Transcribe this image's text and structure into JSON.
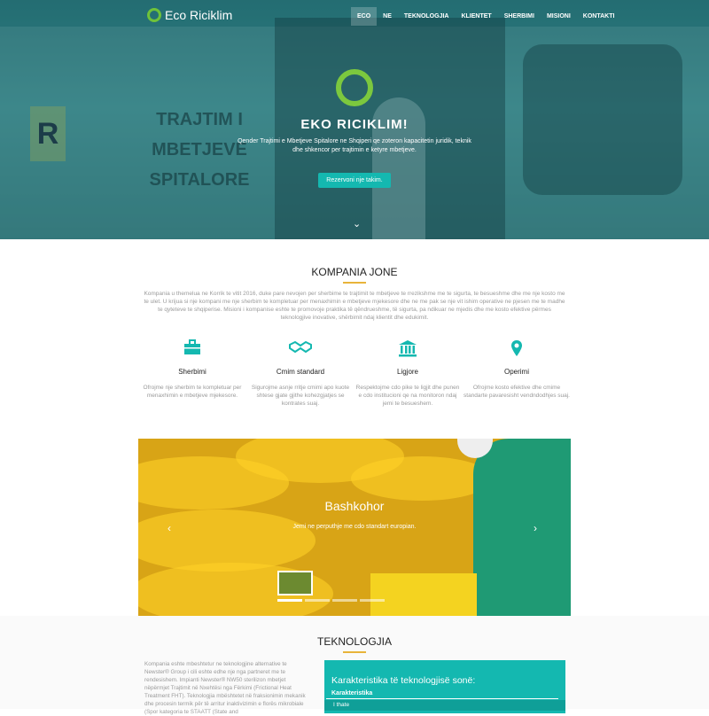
{
  "header": {
    "brand": "Eco Riciklim",
    "menu": [
      {
        "label": "ECO",
        "active": true
      },
      {
        "label": "NE",
        "active": false
      },
      {
        "label": "TEKNOLOGJIA",
        "active": false
      },
      {
        "label": "KLIENTET",
        "active": false
      },
      {
        "label": "SHERBIMI",
        "active": false
      },
      {
        "label": "MISIONI",
        "active": false
      },
      {
        "label": "KONTAKTI",
        "active": false
      }
    ]
  },
  "hero": {
    "van_letter": "R",
    "van_text": "TRAJTIM I MBETJEVE SPITALORE",
    "title": "EKO RICIKLIM!",
    "subtitle": "Qender Trajtimi e Mbetjeve Spitalore ne Shqiperi qe zoteron kapacitetin juridik, teknik dhe shkencor per trajtimin e ketyre mbetjeve.",
    "cta": "Rezervoni nje takim.",
    "scroll_icon": "chevron-down-icon"
  },
  "company": {
    "title": "KOMPANIA JONE",
    "text": "Kompania u themelua ne Korrik te vitit 2016, duke pare nevojen per sherbime te trajtimit te mbetjeve te rrezikshme me te sigurta, te besueshme dhe me nje kosto me te ulet. U krijua si nje kompani me nje sherbim te kompletuar per menaxhimin e mbetjeve mjekesore dhe ne me pak se nje vit ishim operative ne pjesen me te madhe te qyteteve te shqiperise. Misioni i kompanise eshte te promovoje praktika të qëndrueshme, të sigurta, pa ndikuar ne mjedis dhe me kosto efektive përmes teknologjive inovative, shërbimit ndaj klientit dhe edukimit.",
    "features": [
      {
        "icon": "briefcase-icon",
        "title": "Sherbimi",
        "desc": "Ofrojme nje sherbim te kompletuar per menaxhimin e mbetjeve mjekesore."
      },
      {
        "icon": "handshake-icon",
        "title": "Cmim standard",
        "desc": "Sigurojme asnje rritje cmimi apo kuote shtese gjate gjithe kohezgjatjes se kontrates suaj."
      },
      {
        "icon": "institution-icon",
        "title": "Ligjore",
        "desc": "Respektojme cdo pike te ligjit dhe punen e cdo institucioni qe na monitoron ndaj jemi te besueshem."
      },
      {
        "icon": "map-marker-icon",
        "title": "Operimi",
        "desc": "Ofrojme kosto efektive dhe cmime standarte pavaresisht vendndodhjes suaj."
      }
    ]
  },
  "slider": {
    "title": "Bashkohor",
    "subtitle": "Jemi ne perputhje me cdo standart europian.",
    "prev_icon": "chevron-left-icon",
    "next_icon": "chevron-right-icon",
    "active_index": 0,
    "count": 4
  },
  "technology": {
    "title": "TEKNOLOGJIA",
    "text": "Kompania eshte mbeshtetur ne teknologjine alternative te Newster® Group i cili eshte edhe nje nga partneret me te rendesishem. Impianti Newster® NW50 sterilizon mbetjet nëpërmjet Trajtimit në Nxehtësi nga Fërkimi (Frictional Heat Treatment FHT). Teknologjia mbështetet në fraksionimin mekanik dhe procesin termik për të arritur inaktivizimin e florës mikrobiale (Spor kategoria te STAATT (State and",
    "box_title": "Karakteristika të teknologjisë sonë:",
    "box_header": "Karakteristika",
    "box_row": "I thate"
  },
  "colors": {
    "accent": "#14b8b0",
    "brand_green": "#7cc83e",
    "gold": "#e8b43a"
  }
}
